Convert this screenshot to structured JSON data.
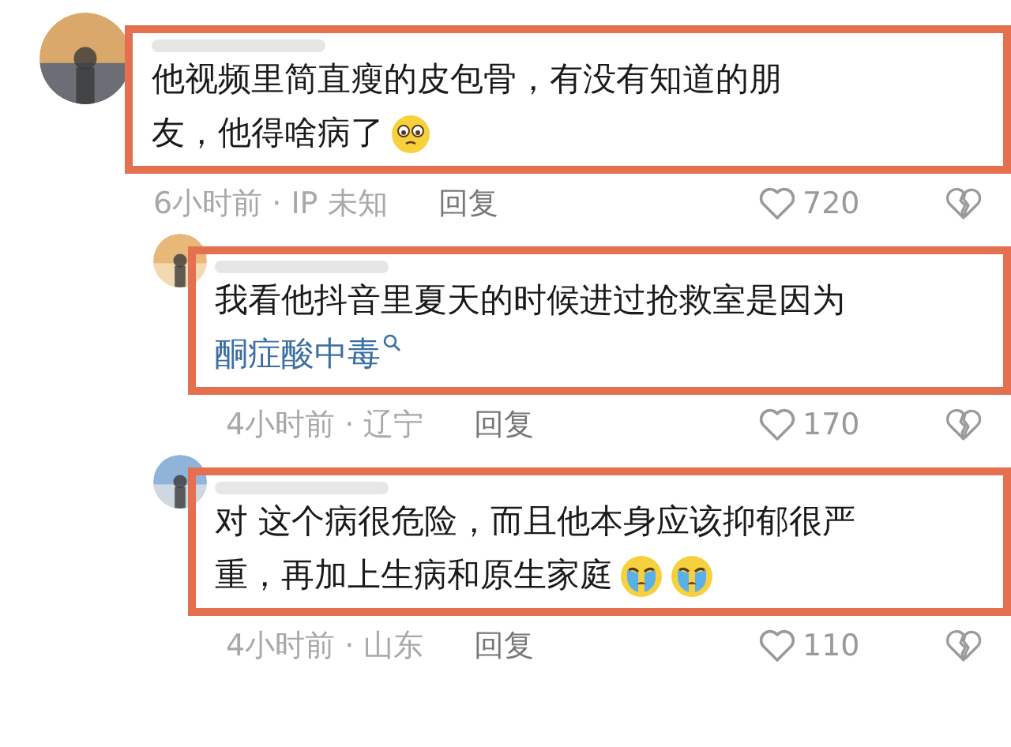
{
  "comments": [
    {
      "text": "他视频里简直瘦的皮包骨，有没有知道的朋友，他得啥病了",
      "emojis": [
        {
          "kind": "teary"
        }
      ],
      "time": "6小时前 · IP 未知",
      "reply": "回复",
      "likes": "720",
      "children": [
        {
          "text": "我看他抖音里夏天的时候进过抢救室是因为",
          "link": "酮症酸中毒",
          "time": "4小时前 · 辽宁",
          "reply": "回复",
          "likes": "170"
        },
        {
          "text": "对 这个病很危险，而且他本身应该抑郁很严重，再加上生病和原生家庭",
          "emojis": [
            {
              "kind": "crying"
            },
            {
              "kind": "crying"
            }
          ],
          "time": "4小时前 · 山东",
          "reply": "回复",
          "likes": "110"
        }
      ]
    }
  ]
}
